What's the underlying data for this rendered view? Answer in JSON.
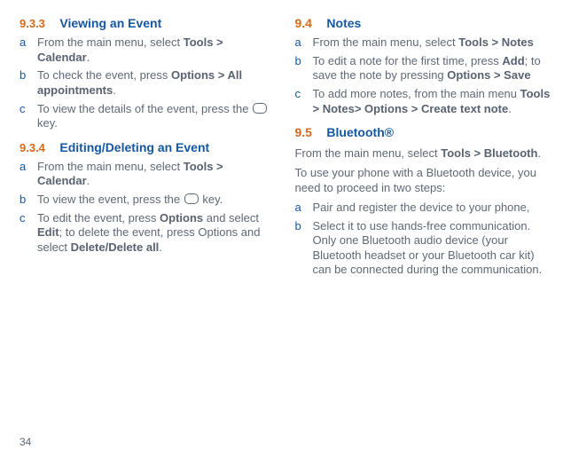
{
  "page_number": "34",
  "left": {
    "sec1_num": "9.3.3",
    "sec1_title": "Viewing an Event",
    "sec1_steps": [
      "From the main menu, select <b>Tools > Calendar</b>.",
      "To check the event, press <b>Options > All appointments</b>.",
      "To view the details of the event, press the [KEY] key."
    ],
    "sec2_num": "9.3.4",
    "sec2_title": "Editing/Deleting an Event",
    "sec2_steps": [
      "From the main menu, select <b>Tools > Calendar</b>.",
      "To view the event, press the [KEY] key.",
      "To edit the event, press <b>Options</b> and select <b>Edit</b>; to delete the event, press Options and select <b>Delete/Delete all</b>."
    ]
  },
  "right": {
    "sec1_num": "9.4",
    "sec1_title": "Notes",
    "sec1_steps": [
      "From the main menu, select <b>Tools > Notes</b>",
      "To edit a note for the first time, press <b>Add</b>; to save the note by pressing <b>Options > Save</b>",
      "To add more notes, from the main menu <b>Tools > Notes> Options > Create text note</b>."
    ],
    "sec2_num": "9.5",
    "sec2_title": "Bluetooth®",
    "sec2_intro1": "From the main menu, select <b>Tools > Bluetooth</b>.",
    "sec2_intro2": "To use your phone with a Bluetooth device, you need to proceed in two steps:",
    "sec2_steps": [
      "Pair and register the device to your phone,",
      "Select it to use hands-free communication. Only one Bluetooth audio device (your Bluetooth headset or your Bluetooth car kit) can be connected during the communication."
    ]
  }
}
